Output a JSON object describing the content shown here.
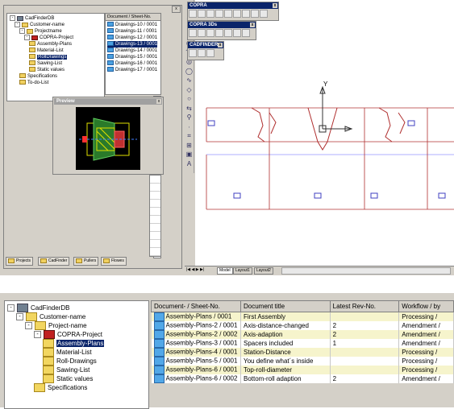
{
  "top": {
    "tree": [
      {
        "label": "CadFinderDB",
        "level": 0,
        "type": "db",
        "pm": "-"
      },
      {
        "label": "Customer-name",
        "level": 1,
        "type": "folder",
        "pm": "-"
      },
      {
        "label": "Projectname",
        "level": 2,
        "type": "folder",
        "pm": "-"
      },
      {
        "label": "COPRA-Project",
        "level": 3,
        "type": "copra",
        "pm": "-"
      },
      {
        "label": "Assembly-Plans",
        "level": 4,
        "type": "folder",
        "pm": ""
      },
      {
        "label": "Material-List",
        "level": 4,
        "type": "folder",
        "pm": ""
      },
      {
        "label": "RollDrawings",
        "level": 4,
        "type": "folder",
        "pm": "",
        "selected": true
      },
      {
        "label": "Sawing-List",
        "level": 4,
        "type": "folder",
        "pm": ""
      },
      {
        "label": "Static values",
        "level": 4,
        "type": "folder",
        "pm": ""
      },
      {
        "label": "Specifications",
        "level": 2,
        "type": "folder",
        "pm": ""
      },
      {
        "label": "To-do-List",
        "level": 2,
        "type": "folder",
        "pm": ""
      }
    ],
    "list_header": "Document / Sheet-No.",
    "list_items": [
      "Drawings-10 / 0001",
      "Drawings-11 / 0001",
      "Drawings-12 / 0001",
      "Drawings-13 / 0001",
      "Drawings-14 / 0001",
      "Drawings-15 / 0001",
      "Drawings-16 / 0001",
      "Drawings-17 / 0001"
    ],
    "preview_title": "Preview",
    "preview_close": "x",
    "bottom_tabs": [
      "Projects",
      "CadFinder",
      "Pullers",
      "Flowes"
    ],
    "toolbars": [
      {
        "title": "COPRA",
        "close": "x"
      },
      {
        "title": "COPRA 3Ds",
        "close": "x"
      },
      {
        "title": "CADFINDER",
        "close": "x"
      }
    ],
    "layout_tabs": [
      "Model",
      "Layout1",
      "Layout2"
    ],
    "axis_y": "Y",
    "accent": "#0a246a",
    "drawing_line": "#b03030",
    "window_close": "x"
  },
  "bottom": {
    "tree": [
      {
        "label": "CadFinderDB",
        "level": 0,
        "type": "db",
        "pm": "-"
      },
      {
        "label": "Customer-name",
        "level": 1,
        "type": "folder",
        "pm": "-"
      },
      {
        "label": "Project-name",
        "level": 2,
        "type": "folder",
        "pm": "-"
      },
      {
        "label": "COPRA-Project",
        "level": 3,
        "type": "copra",
        "pm": "-"
      },
      {
        "label": "Assembly-Plans",
        "level": 4,
        "type": "folder",
        "pm": "",
        "selected": true
      },
      {
        "label": "Material-List",
        "level": 4,
        "type": "folder",
        "pm": ""
      },
      {
        "label": "Roll-Drawings",
        "level": 4,
        "type": "folder",
        "pm": ""
      },
      {
        "label": "Sawing-List",
        "level": 4,
        "type": "folder",
        "pm": ""
      },
      {
        "label": "Static values",
        "level": 4,
        "type": "folder",
        "pm": ""
      },
      {
        "label": "Specifications",
        "level": 3,
        "type": "folder",
        "pm": ""
      }
    ],
    "columns": [
      "Document- / Sheet-No.",
      "Document title",
      "Latest Rev-No.",
      "Workflow / by"
    ],
    "rows": [
      {
        "doc": "Assembly-Plans / 0001",
        "title": "First Assembly",
        "rev": "",
        "workflow": "Processing /"
      },
      {
        "doc": "Assembly-Plans-2 / 0001",
        "title": "Axis-distance-changed",
        "rev": "2",
        "workflow": "Amendment /"
      },
      {
        "doc": "Assembly-Plans-2 / 0002",
        "title": "Axis-adaption",
        "rev": "2",
        "workflow": "Amendment /"
      },
      {
        "doc": "Assembly-Plans-3 / 0001",
        "title": "Spacers included",
        "rev": "1",
        "workflow": "Amendment /"
      },
      {
        "doc": "Assembly-Plans-4 / 0001",
        "title": "Station-Distance",
        "rev": "",
        "workflow": "Processing /"
      },
      {
        "doc": "Assembly-Plans-5 / 0001",
        "title": "You define what´s inside",
        "rev": "",
        "workflow": "Processing /"
      },
      {
        "doc": "Assembly-Plans-6 / 0001",
        "title": "Top-roll-diameter",
        "rev": "",
        "workflow": "Processing /"
      },
      {
        "doc": "Assembly-Plans-6 / 0002",
        "title": "Bottom-roll adaption",
        "rev": "2",
        "workflow": "Amendment /"
      }
    ],
    "row_color": "#f6f4cc",
    "selection_color": "#0a246a"
  }
}
